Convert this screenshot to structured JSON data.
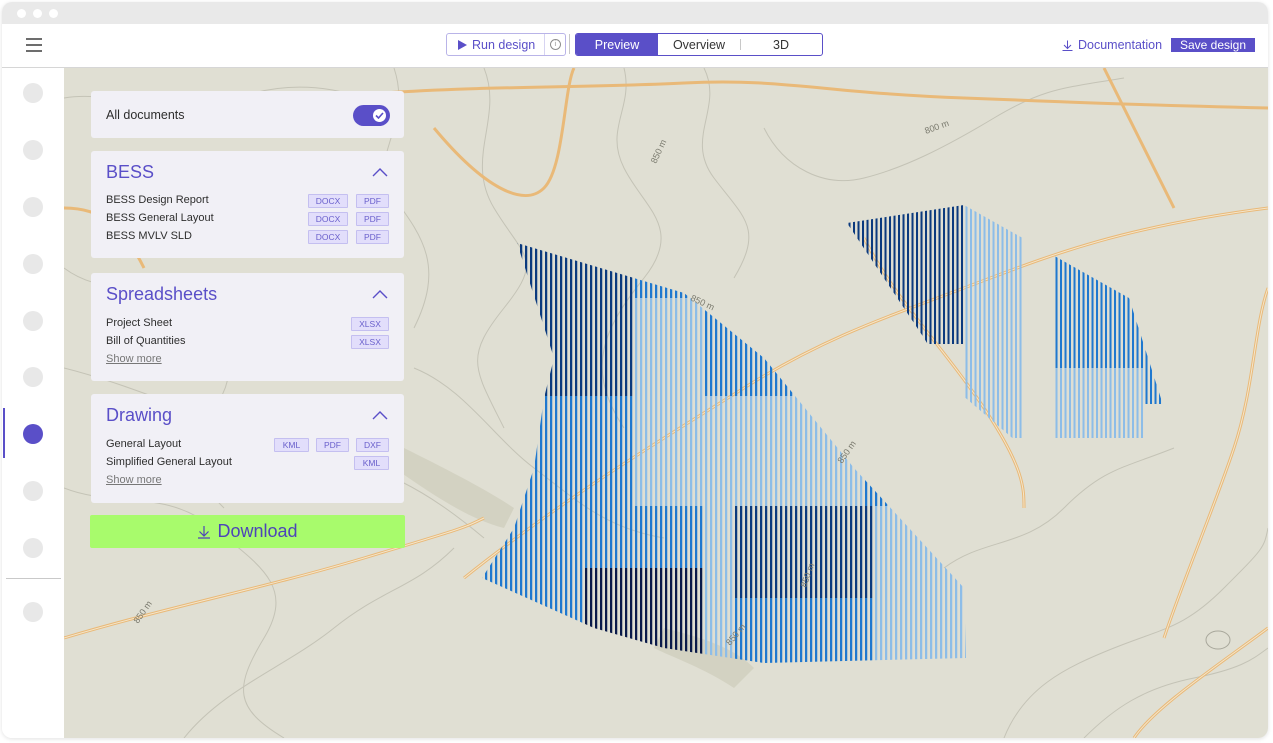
{
  "toolbar": {
    "run_label": "Run design",
    "info_label": "i",
    "view_tabs": [
      {
        "label": "Preview",
        "active": true
      },
      {
        "label": "Overview",
        "active": false
      },
      {
        "label": "3D",
        "active": false
      }
    ],
    "documentation_label": "Documentation",
    "save_label": "Save design"
  },
  "sidebar": {
    "items": [
      {
        "icon": "nav-placeholder-icon",
        "active": false
      },
      {
        "icon": "nav-placeholder-icon",
        "active": false
      },
      {
        "icon": "nav-placeholder-icon",
        "active": false
      },
      {
        "icon": "nav-placeholder-icon",
        "active": false
      },
      {
        "icon": "nav-placeholder-icon",
        "active": false
      },
      {
        "icon": "nav-placeholder-icon",
        "active": false
      },
      {
        "icon": "nav-placeholder-icon",
        "active": true
      },
      {
        "icon": "nav-placeholder-icon",
        "active": false
      },
      {
        "icon": "nav-placeholder-icon",
        "active": false
      },
      {
        "icon": "nav-placeholder-icon",
        "active": false
      }
    ]
  },
  "documents": {
    "all_label": "All documents",
    "all_enabled": true,
    "sections": [
      {
        "title": "BESS",
        "expanded": true,
        "items": [
          {
            "name": "BESS Design Report",
            "formats": [
              "DOCX",
              "PDF"
            ]
          },
          {
            "name": "BESS General Layout",
            "formats": [
              "DOCX",
              "PDF"
            ]
          },
          {
            "name": "BESS MVLV SLD",
            "formats": [
              "DOCX",
              "PDF"
            ]
          }
        ]
      },
      {
        "title": "Spreadsheets",
        "expanded": true,
        "items": [
          {
            "name": "Project Sheet",
            "formats": [
              "XLSX"
            ]
          },
          {
            "name": "Bill of Quantities",
            "formats": [
              "XLSX"
            ]
          }
        ],
        "show_more": "Show more"
      },
      {
        "title": "Drawing",
        "expanded": true,
        "items": [
          {
            "name": "General Layout",
            "formats": [
              "KML",
              "PDF",
              "DXF"
            ]
          },
          {
            "name": "Simplified General Layout",
            "formats": [
              "KML"
            ]
          }
        ],
        "show_more": "Show more"
      }
    ],
    "download_label": "Download"
  },
  "map": {
    "contour_labels": [
      "800 m",
      "850 m",
      "850 m",
      "850 m",
      "850 m",
      "850 m",
      "850 m"
    ],
    "colors": {
      "background": "#e0dfd3",
      "road": "#e9b978",
      "contour": "#bdbcae",
      "row_dark": "#0b3a7e",
      "row_darkest": "#0a1a4a",
      "row_mid": "#1f78cf",
      "row_light": "#8dbde8"
    }
  },
  "colors": {
    "accent": "#5a4fc8",
    "download": "#a8fb6c"
  }
}
